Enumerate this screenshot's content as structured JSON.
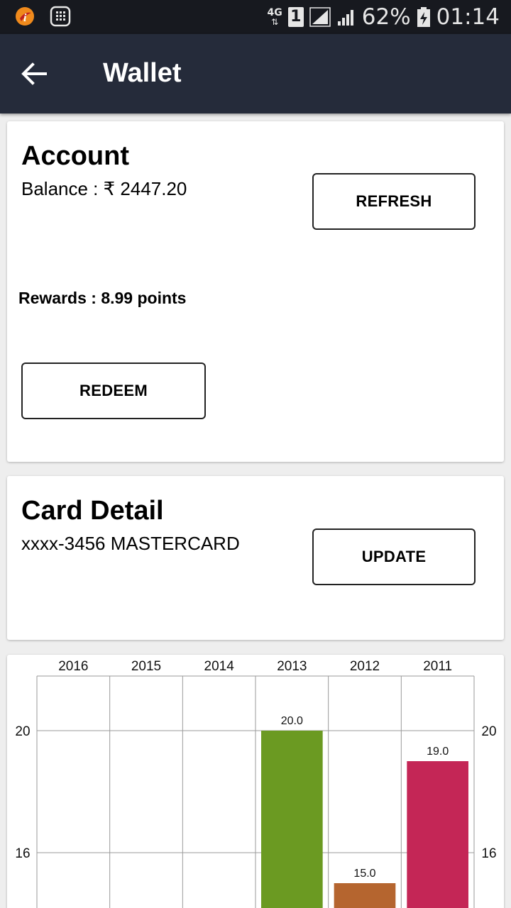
{
  "status_bar": {
    "network_label": "4G",
    "sim_slot": "1",
    "battery_percent": "62%",
    "time": "01:14",
    "left_icons": [
      "ibibo-logo-icon",
      "calculator-icon"
    ]
  },
  "app_bar": {
    "title": "Wallet",
    "back_icon": "arrow-back-icon"
  },
  "account_card": {
    "title": "Account",
    "balance_text": "Balance : ₹ 2447.20",
    "refresh_label": "REFRESH",
    "rewards_text": "Rewards : 8.99 points",
    "redeem_label": "REDEEM"
  },
  "card_detail": {
    "title": "Card Detail",
    "card_text": "xxxx-3456 MASTERCARD",
    "update_label": "UPDATE"
  },
  "chart_data": {
    "type": "bar",
    "categories": [
      "2016",
      "2015",
      "2014",
      "2013",
      "2012",
      "2011"
    ],
    "values": [
      null,
      null,
      null,
      20.0,
      15.0,
      19.0
    ],
    "value_labels": [
      "",
      "",
      "",
      "20.0",
      "15.0",
      "19.0"
    ],
    "colors": [
      "#6b9a22",
      "#6b9a22",
      "#6b9a22",
      "#6b9a22",
      "#b5652f",
      "#c42656"
    ],
    "y_ticks": [
      16,
      20
    ],
    "y_tick_labels": [
      "16",
      "20"
    ],
    "ylim_visible_top": 21.8,
    "category_axis_position": "top",
    "y_axis": "both sides",
    "grid": true
  }
}
